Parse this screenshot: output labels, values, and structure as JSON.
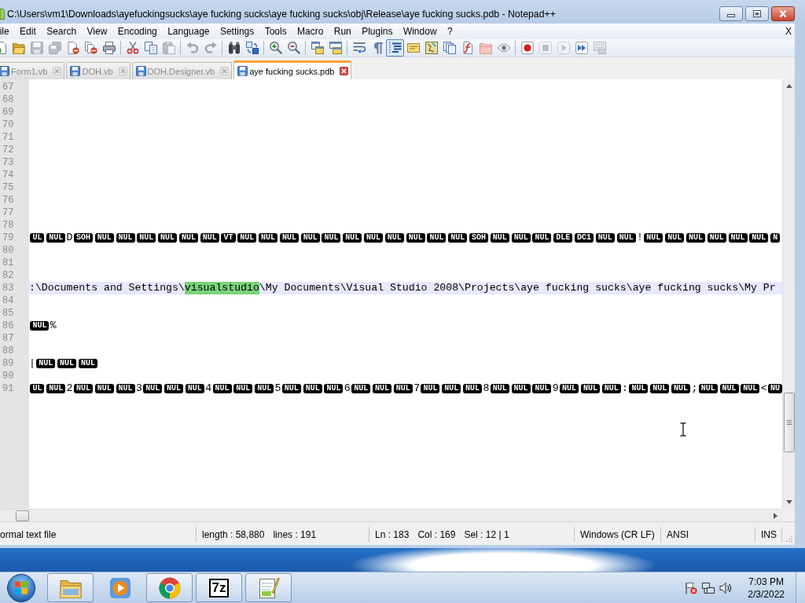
{
  "window": {
    "title": "C:\\Users\\vm1\\Downloads\\ayefuckingsucks\\aye fucking sucks\\aye fucking sucks\\obj\\Release\\aye fucking sucks.pdb - Notepad++"
  },
  "menu": {
    "items": [
      "ile",
      "Edit",
      "Search",
      "View",
      "Encoding",
      "Language",
      "Settings",
      "Tools",
      "Macro",
      "Run",
      "Plugins",
      "Window",
      "?"
    ],
    "close": "X"
  },
  "toolbar": [
    {
      "buttons": [
        {
          "kind": "new",
          "disabled": false,
          "pressed": false
        },
        {
          "kind": "open",
          "disabled": false,
          "pressed": false
        },
        {
          "kind": "save",
          "disabled": true,
          "pressed": false
        },
        {
          "kind": "saveall",
          "disabled": true,
          "pressed": false
        },
        {
          "kind": "close",
          "disabled": false,
          "pressed": false
        },
        {
          "kind": "closeall",
          "disabled": false,
          "pressed": false
        },
        {
          "kind": "print",
          "disabled": false,
          "pressed": false
        }
      ]
    },
    {
      "buttons": [
        {
          "kind": "cut",
          "disabled": false,
          "pressed": false
        },
        {
          "kind": "copy",
          "disabled": false,
          "pressed": false
        },
        {
          "kind": "paste",
          "disabled": true,
          "pressed": false
        }
      ]
    },
    {
      "buttons": [
        {
          "kind": "undo",
          "disabled": true,
          "pressed": false
        },
        {
          "kind": "redo",
          "disabled": true,
          "pressed": false
        }
      ]
    },
    {
      "buttons": [
        {
          "kind": "find",
          "disabled": false,
          "pressed": false
        },
        {
          "kind": "replace",
          "disabled": false,
          "pressed": false
        }
      ]
    },
    {
      "buttons": [
        {
          "kind": "zoomin",
          "disabled": false,
          "pressed": false
        },
        {
          "kind": "zoomout",
          "disabled": false,
          "pressed": false
        }
      ]
    },
    {
      "buttons": [
        {
          "kind": "syncv",
          "disabled": false,
          "pressed": false
        },
        {
          "kind": "synch",
          "disabled": false,
          "pressed": false
        }
      ]
    },
    {
      "buttons": [
        {
          "kind": "wrap",
          "disabled": false,
          "pressed": false
        },
        {
          "kind": "allchars",
          "disabled": false,
          "pressed": false
        },
        {
          "kind": "indent",
          "disabled": false,
          "pressed": true
        },
        {
          "kind": "udl",
          "disabled": false,
          "pressed": false
        },
        {
          "kind": "docmap",
          "disabled": false,
          "pressed": false
        },
        {
          "kind": "doclist",
          "disabled": false,
          "pressed": false
        },
        {
          "kind": "funclist",
          "disabled": false,
          "pressed": false
        },
        {
          "kind": "workspace",
          "disabled": false,
          "pressed": false
        },
        {
          "kind": "monitor",
          "disabled": false,
          "pressed": false
        }
      ]
    },
    {
      "buttons": [
        {
          "kind": "record",
          "disabled": false,
          "pressed": false
        },
        {
          "kind": "stop",
          "disabled": true,
          "pressed": false
        },
        {
          "kind": "play",
          "disabled": true,
          "pressed": false
        },
        {
          "kind": "playmulti",
          "disabled": false,
          "pressed": false
        },
        {
          "kind": "savemacro",
          "disabled": true,
          "pressed": false
        }
      ]
    }
  ],
  "tabs": [
    {
      "label": "Form1.vb",
      "selected": false
    },
    {
      "label": "DOH.vb",
      "selected": false
    },
    {
      "label": "DOH.Designer.vb",
      "selected": false
    },
    {
      "label": "aye fucking sucks.pdb",
      "selected": true
    }
  ],
  "editor": {
    "lines": [
      {
        "number": "67",
        "current": false
      },
      {
        "number": "68",
        "current": false
      },
      {
        "number": "69",
        "current": false
      },
      {
        "number": "70",
        "current": false
      },
      {
        "number": "71",
        "current": false
      },
      {
        "number": "72",
        "current": false
      },
      {
        "number": "73",
        "current": false
      },
      {
        "number": "74",
        "current": false
      },
      {
        "number": "75",
        "current": false
      },
      {
        "number": "76",
        "current": false
      },
      {
        "number": "77",
        "current": false
      },
      {
        "number": "78",
        "current": false
      },
      {
        "number": "79",
        "current": false,
        "tokens": [
          {
            "kind": "ctrl",
            "text": "UL"
          },
          {
            "kind": "ctrl",
            "text": "NUL"
          },
          {
            "kind": "text",
            "text": "D"
          },
          {
            "kind": "ctrl",
            "text": "SOH"
          },
          {
            "kind": "ctrl",
            "text": "NUL"
          },
          {
            "kind": "ctrl",
            "text": "NUL"
          },
          {
            "kind": "ctrl",
            "text": "NUL"
          },
          {
            "kind": "ctrl",
            "text": "NUL"
          },
          {
            "kind": "ctrl",
            "text": "NUL"
          },
          {
            "kind": "ctrl",
            "text": "NUL"
          },
          {
            "kind": "ctrl",
            "text": "VT"
          },
          {
            "kind": "ctrl",
            "text": "NUL"
          },
          {
            "kind": "ctrl",
            "text": "NUL"
          },
          {
            "kind": "ctrl",
            "text": "NUL"
          },
          {
            "kind": "ctrl",
            "text": "NUL"
          },
          {
            "kind": "ctrl",
            "text": "NUL"
          },
          {
            "kind": "ctrl",
            "text": "NUL"
          },
          {
            "kind": "ctrl",
            "text": "NUL"
          },
          {
            "kind": "ctrl",
            "text": "NUL"
          },
          {
            "kind": "ctrl",
            "text": "NUL"
          },
          {
            "kind": "ctrl",
            "text": "NUL"
          },
          {
            "kind": "ctrl",
            "text": "NUL"
          },
          {
            "kind": "ctrl",
            "text": "SOH"
          },
          {
            "kind": "ctrl",
            "text": "NUL"
          },
          {
            "kind": "ctrl",
            "text": "NUL"
          },
          {
            "kind": "ctrl",
            "text": "NUL"
          },
          {
            "kind": "ctrl",
            "text": "DLE"
          },
          {
            "kind": "ctrl",
            "text": "DC1"
          },
          {
            "kind": "ctrl",
            "text": "NUL"
          },
          {
            "kind": "ctrl",
            "text": "NUL"
          },
          {
            "kind": "text",
            "text": "!"
          },
          {
            "kind": "ctrl",
            "text": "NUL"
          },
          {
            "kind": "ctrl",
            "text": "NUL"
          },
          {
            "kind": "ctrl",
            "text": "NUL"
          },
          {
            "kind": "ctrl",
            "text": "NUL"
          },
          {
            "kind": "ctrl",
            "text": "NUL"
          },
          {
            "kind": "ctrl",
            "text": "NUL"
          },
          {
            "kind": "ctrl",
            "text": "N"
          }
        ]
      },
      {
        "number": "80",
        "current": false
      },
      {
        "number": "81",
        "current": false
      },
      {
        "number": "82",
        "current": false
      },
      {
        "number": "83",
        "current": true,
        "tokens": [
          {
            "kind": "text",
            "text": ":\\Documents and Settings\\"
          },
          {
            "kind": "selection",
            "text": "visualstudio"
          },
          {
            "kind": "text",
            "text": "\\My Documents\\Visual Studio 2008\\Projects\\aye fucking sucks\\aye fucking sucks\\My Pr"
          }
        ]
      },
      {
        "number": "84",
        "current": false
      },
      {
        "number": "85",
        "current": false
      },
      {
        "number": "86",
        "current": false,
        "tokens": [
          {
            "kind": "ctrl",
            "text": "NUL"
          },
          {
            "kind": "text",
            "text": "%"
          }
        ]
      },
      {
        "number": "87",
        "current": false
      },
      {
        "number": "88",
        "current": false
      },
      {
        "number": "89",
        "current": false,
        "tokens": [
          {
            "kind": "text",
            "text": "|"
          },
          {
            "kind": "ctrl",
            "text": "NUL"
          },
          {
            "kind": "ctrl",
            "text": "NUL"
          },
          {
            "kind": "ctrl",
            "text": "NUL"
          }
        ]
      },
      {
        "number": "90",
        "current": false
      },
      {
        "number": "91",
        "current": false,
        "tokens": [
          {
            "kind": "ctrl",
            "text": "UL"
          },
          {
            "kind": "ctrl",
            "text": "NUL"
          },
          {
            "kind": "text",
            "text": "2"
          },
          {
            "kind": "ctrl",
            "text": "NUL"
          },
          {
            "kind": "ctrl",
            "text": "NUL"
          },
          {
            "kind": "ctrl",
            "text": "NUL"
          },
          {
            "kind": "text",
            "text": "3"
          },
          {
            "kind": "ctrl",
            "text": "NUL"
          },
          {
            "kind": "ctrl",
            "text": "NUL"
          },
          {
            "kind": "ctrl",
            "text": "NUL"
          },
          {
            "kind": "text",
            "text": "4"
          },
          {
            "kind": "ctrl",
            "text": "NUL"
          },
          {
            "kind": "ctrl",
            "text": "NUL"
          },
          {
            "kind": "ctrl",
            "text": "NUL"
          },
          {
            "kind": "text",
            "text": "5"
          },
          {
            "kind": "ctrl",
            "text": "NUL"
          },
          {
            "kind": "ctrl",
            "text": "NUL"
          },
          {
            "kind": "ctrl",
            "text": "NUL"
          },
          {
            "kind": "text",
            "text": "6"
          },
          {
            "kind": "ctrl",
            "text": "NUL"
          },
          {
            "kind": "ctrl",
            "text": "NUL"
          },
          {
            "kind": "ctrl",
            "text": "NUL"
          },
          {
            "kind": "text",
            "text": "7"
          },
          {
            "kind": "ctrl",
            "text": "NUL"
          },
          {
            "kind": "ctrl",
            "text": "NUL"
          },
          {
            "kind": "ctrl",
            "text": "NUL"
          },
          {
            "kind": "text",
            "text": "8"
          },
          {
            "kind": "ctrl",
            "text": "NUL"
          },
          {
            "kind": "ctrl",
            "text": "NUL"
          },
          {
            "kind": "ctrl",
            "text": "NUL"
          },
          {
            "kind": "text",
            "text": "9"
          },
          {
            "kind": "ctrl",
            "text": "NUL"
          },
          {
            "kind": "ctrl",
            "text": "NUL"
          },
          {
            "kind": "ctrl",
            "text": "NUL"
          },
          {
            "kind": "text",
            "text": ":"
          },
          {
            "kind": "ctrl",
            "text": "NUL"
          },
          {
            "kind": "ctrl",
            "text": "NUL"
          },
          {
            "kind": "ctrl",
            "text": "NUL"
          },
          {
            "kind": "text",
            "text": ";"
          },
          {
            "kind": "ctrl",
            "text": "NUL"
          },
          {
            "kind": "ctrl",
            "text": "NUL"
          },
          {
            "kind": "ctrl",
            "text": "NUL"
          },
          {
            "kind": "text",
            "text": "<"
          },
          {
            "kind": "ctrl",
            "text": "NU"
          }
        ]
      }
    ]
  },
  "status_bar": [
    {
      "texts": [
        "ormal text file"
      ]
    },
    {
      "texts": [
        "length : 58,880",
        "lines : 191"
      ]
    },
    {
      "texts": [
        "Ln : 183",
        "Col : 169",
        "Sel : 12 | 1"
      ]
    },
    {
      "texts": [
        "Windows (CR LF)"
      ]
    },
    {
      "texts": [
        "ANSI"
      ]
    },
    {
      "texts": [
        "INS"
      ]
    }
  ],
  "taskbar": {
    "apps": [
      {
        "kind": "explorer",
        "running": true
      },
      {
        "kind": "media",
        "running": false
      },
      {
        "kind": "browser",
        "running": true
      },
      {
        "kind": "archiver",
        "logo": "7z",
        "running": true
      },
      {
        "kind": "editor",
        "running": true
      }
    ],
    "tray": {
      "time": "7:03 PM",
      "date": "2/3/2022"
    }
  }
}
